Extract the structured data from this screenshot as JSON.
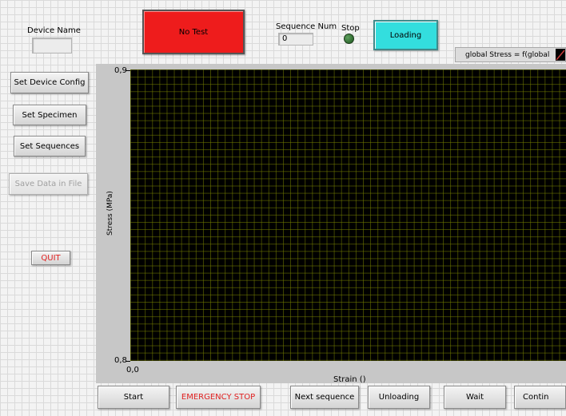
{
  "device": {
    "name_label": "Device Name",
    "name_value": ""
  },
  "status": {
    "label": "No Test",
    "color": "#ee1c1c"
  },
  "sequence": {
    "label": "Sequence Num",
    "value": "0"
  },
  "stop": {
    "label": "Stop",
    "led_color": "#2f6b2f"
  },
  "mode": {
    "label": "Loading",
    "color": "#33dede"
  },
  "legend": {
    "label": "global Stress =  f(global"
  },
  "sidebar": {
    "set_device_config": "Set Device Config",
    "set_specimen": "Set  Specimen",
    "set_sequences": "Set Sequences",
    "save_data": "Save Data in File",
    "quit": "QUIT"
  },
  "chart_data": {
    "type": "line",
    "title": "",
    "xlabel": "Strain ()",
    "ylabel": "Stress (MPa)",
    "y_tick_labels": [
      "0,9",
      "0,8"
    ],
    "x_tick_labels": [
      "0,0"
    ],
    "ylim": [
      0.8,
      0.9
    ],
    "xlim": [
      0.0,
      null
    ],
    "series": [],
    "grid": true,
    "background": "#000000",
    "grid_color": "#6e7a00"
  },
  "bottom": {
    "start": "Start",
    "emergency": "EMERGENCY STOP",
    "next": "Next sequence",
    "unloading": "Unloading",
    "wait": "Wait",
    "continue": "Contin"
  }
}
